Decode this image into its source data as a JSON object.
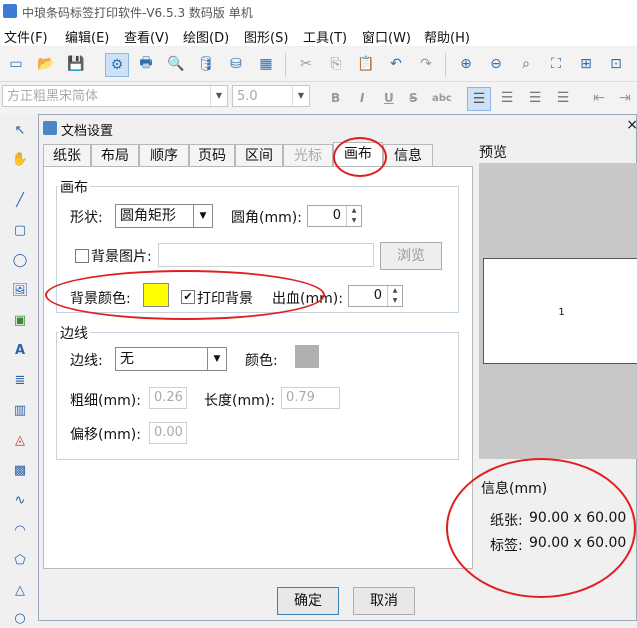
{
  "app": {
    "title": "中琅条码标签打印软件-V6.5.3 数码版 单机"
  },
  "menu": [
    "文件(F)",
    "编辑(E)",
    "查看(V)",
    "绘图(D)",
    "图形(S)",
    "工具(T)",
    "窗口(W)",
    "帮助(H)"
  ],
  "format_bar": {
    "font": "方正粗黑宋简体",
    "size": "5.0",
    "bold": "B",
    "italic": "I",
    "underline": "U",
    "strike": "S",
    "abc": "abc"
  },
  "dialog": {
    "title": "文档设置",
    "close": "×",
    "tabs": [
      "纸张",
      "布局",
      "顺序",
      "页码",
      "区间",
      "光标",
      "画布",
      "信息"
    ],
    "active_tab": "画布",
    "canvas": {
      "group_label": "画布",
      "shape_label": "形状:",
      "shape_value": "圆角矩形",
      "corner_label": "圆角(mm):",
      "corner_value": "0",
      "bg_image_label": "背景图片:",
      "browse": "浏览",
      "bg_color_label": "背景颜色:",
      "bg_color": "#ffff00",
      "print_bg_label": "打印背景",
      "print_bg_check": "✔",
      "bleed_label": "出血(mm):",
      "bleed_value": "0"
    },
    "border": {
      "group_label": "边线",
      "border_label": "边线:",
      "border_value": "无",
      "color_label": "颜色:",
      "color": "#b0b0b0",
      "width_label": "粗细(mm):",
      "width_value": "0.26",
      "length_label": "长度(mm):",
      "length_value": "0.79",
      "offset_label": "偏移(mm):",
      "offset_value": "0.00"
    },
    "preview": {
      "label": "预览",
      "label_number": "1"
    },
    "info": {
      "title": "信息(mm)",
      "paper_label": "纸张:",
      "paper_value": "90.00 x 60.00",
      "label_label": "标签:",
      "label_value": "90.00 x 60.00"
    },
    "ok": "确定",
    "cancel": "取消"
  },
  "annotation_color": "#e02020"
}
